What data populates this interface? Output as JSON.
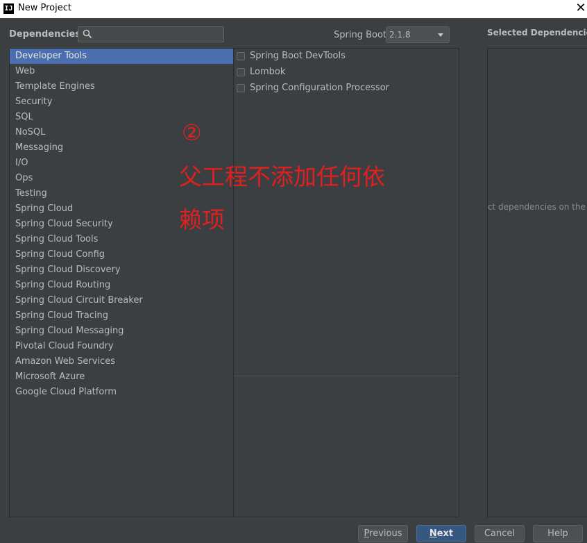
{
  "window": {
    "title": "New Project",
    "app_icon": "IJ"
  },
  "toolbar": {
    "dependencies_label": "Dependencies",
    "search_value": "",
    "spring_boot_label": "Spring Boot",
    "spring_boot_version": "2.1.8"
  },
  "categories": [
    "Developer Tools",
    "Web",
    "Template Engines",
    "Security",
    "SQL",
    "NoSQL",
    "Messaging",
    "I/O",
    "Ops",
    "Testing",
    "Spring Cloud",
    "Spring Cloud Security",
    "Spring Cloud Tools",
    "Spring Cloud Config",
    "Spring Cloud Discovery",
    "Spring Cloud Routing",
    "Spring Cloud Circuit Breaker",
    "Spring Cloud Tracing",
    "Spring Cloud Messaging",
    "Pivotal Cloud Foundry",
    "Amazon Web Services",
    "Microsoft Azure",
    "Google Cloud Platform"
  ],
  "selected_category_index": 0,
  "dependencies": [
    {
      "label": "Spring Boot DevTools",
      "checked": false
    },
    {
      "label": "Lombok",
      "checked": false
    },
    {
      "label": "Spring Configuration Processor",
      "checked": false
    }
  ],
  "selected_panel": {
    "title": "Selected Dependencies",
    "hint": "ect dependencies on the"
  },
  "annotation": {
    "number": "②",
    "line1": "父工程不添加任何依",
    "line2": "赖项"
  },
  "buttons": {
    "previous_mnemonic": "P",
    "previous_rest": "revious",
    "next_mnemonic": "N",
    "next_rest": "ext",
    "cancel": "Cancel",
    "help": "Help"
  },
  "colors": {
    "background": "#3c3f41",
    "selection": "#4b6eaf",
    "primary_button": "#365880",
    "annotation": "#e02020"
  }
}
